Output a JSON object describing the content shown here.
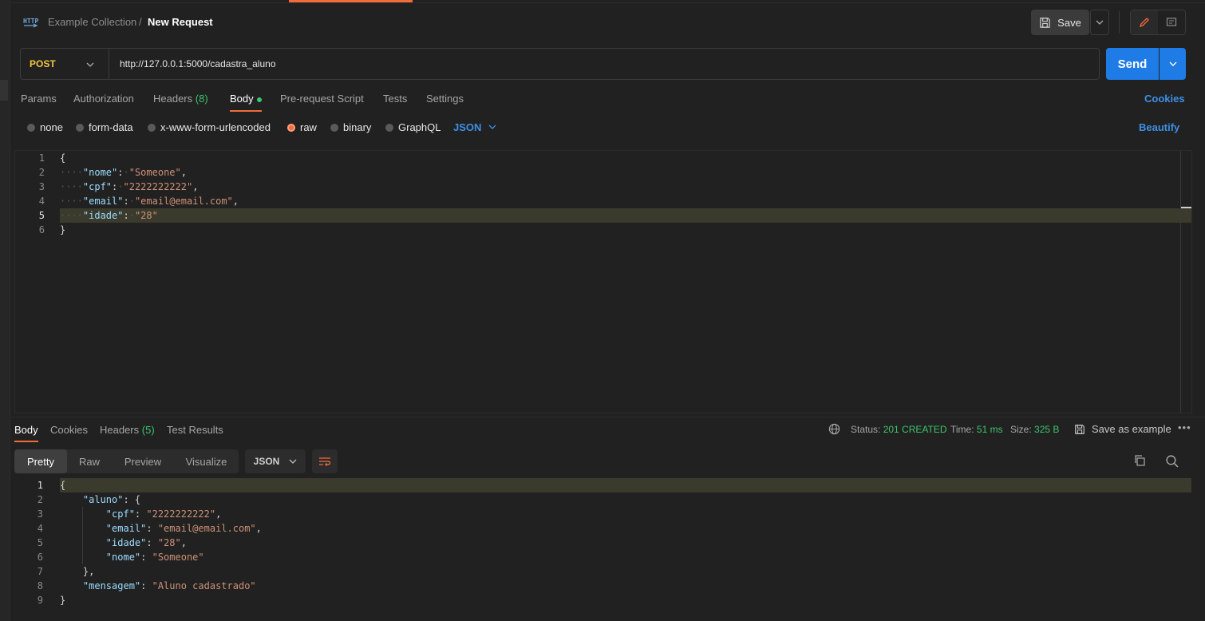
{
  "breadcrumb": {
    "collection": "Example Collection",
    "separator": "/",
    "request": "New Request"
  },
  "header": {
    "save_label": "Save"
  },
  "request": {
    "method": "POST",
    "url": "http://127.0.0.1:5000/cadastra_aluno",
    "send_label": "Send"
  },
  "req_tabs": {
    "params": "Params",
    "authorization": "Authorization",
    "headers": "Headers",
    "headers_count": "(8)",
    "body": "Body",
    "pre_request": "Pre-request Script",
    "tests": "Tests",
    "settings": "Settings",
    "cookies": "Cookies"
  },
  "body_types": {
    "none": "none",
    "form_data": "form-data",
    "urlencoded": "x-www-form-urlencoded",
    "raw": "raw",
    "binary": "binary",
    "graphql": "GraphQL",
    "format": "JSON",
    "beautify": "Beautify"
  },
  "request_body": {
    "line_numbers": [
      "1",
      "2",
      "3",
      "4",
      "5",
      "6"
    ],
    "l1": "{",
    "k2": "\"nome\"",
    "v2": "\"Someone\"",
    "k3": "\"cpf\"",
    "v3": "\"2222222222\"",
    "k4": "\"email\"",
    "v4": "\"email@email.com\"",
    "k5": "\"idade\"",
    "v5": "\"28\"",
    "l6": "}"
  },
  "response_tabs": {
    "body": "Body",
    "cookies": "Cookies",
    "headers": "Headers",
    "headers_count": "(5)",
    "test_results": "Test Results"
  },
  "response_meta": {
    "status_label": "Status:",
    "status_value": "201 CREATED",
    "time_label": "Time:",
    "time_value": "51 ms",
    "size_label": "Size:",
    "size_value": "325 B",
    "save_example": "Save as example"
  },
  "view_modes": {
    "pretty": "Pretty",
    "raw": "Raw",
    "preview": "Preview",
    "visualize": "Visualize",
    "format": "JSON"
  },
  "response_body": {
    "line_numbers": [
      "1",
      "2",
      "3",
      "4",
      "5",
      "6",
      "7",
      "8",
      "9"
    ],
    "l1": "{",
    "k2": "\"aluno\"",
    "k3": "\"cpf\"",
    "v3": "\"2222222222\"",
    "k4": "\"email\"",
    "v4": "\"email@email.com\"",
    "k5": "\"idade\"",
    "v5": "\"28\"",
    "k6": "\"nome\"",
    "v6": "\"Someone\"",
    "l7": "},",
    "k8": "\"mensagem\"",
    "v8": "\"Aluno cadastrado\"",
    "l9": "}"
  },
  "colors": {
    "accent": "#f26b3a",
    "primary": "#1f7ce6",
    "success": "#3ec46d",
    "method": "#f5c542"
  }
}
